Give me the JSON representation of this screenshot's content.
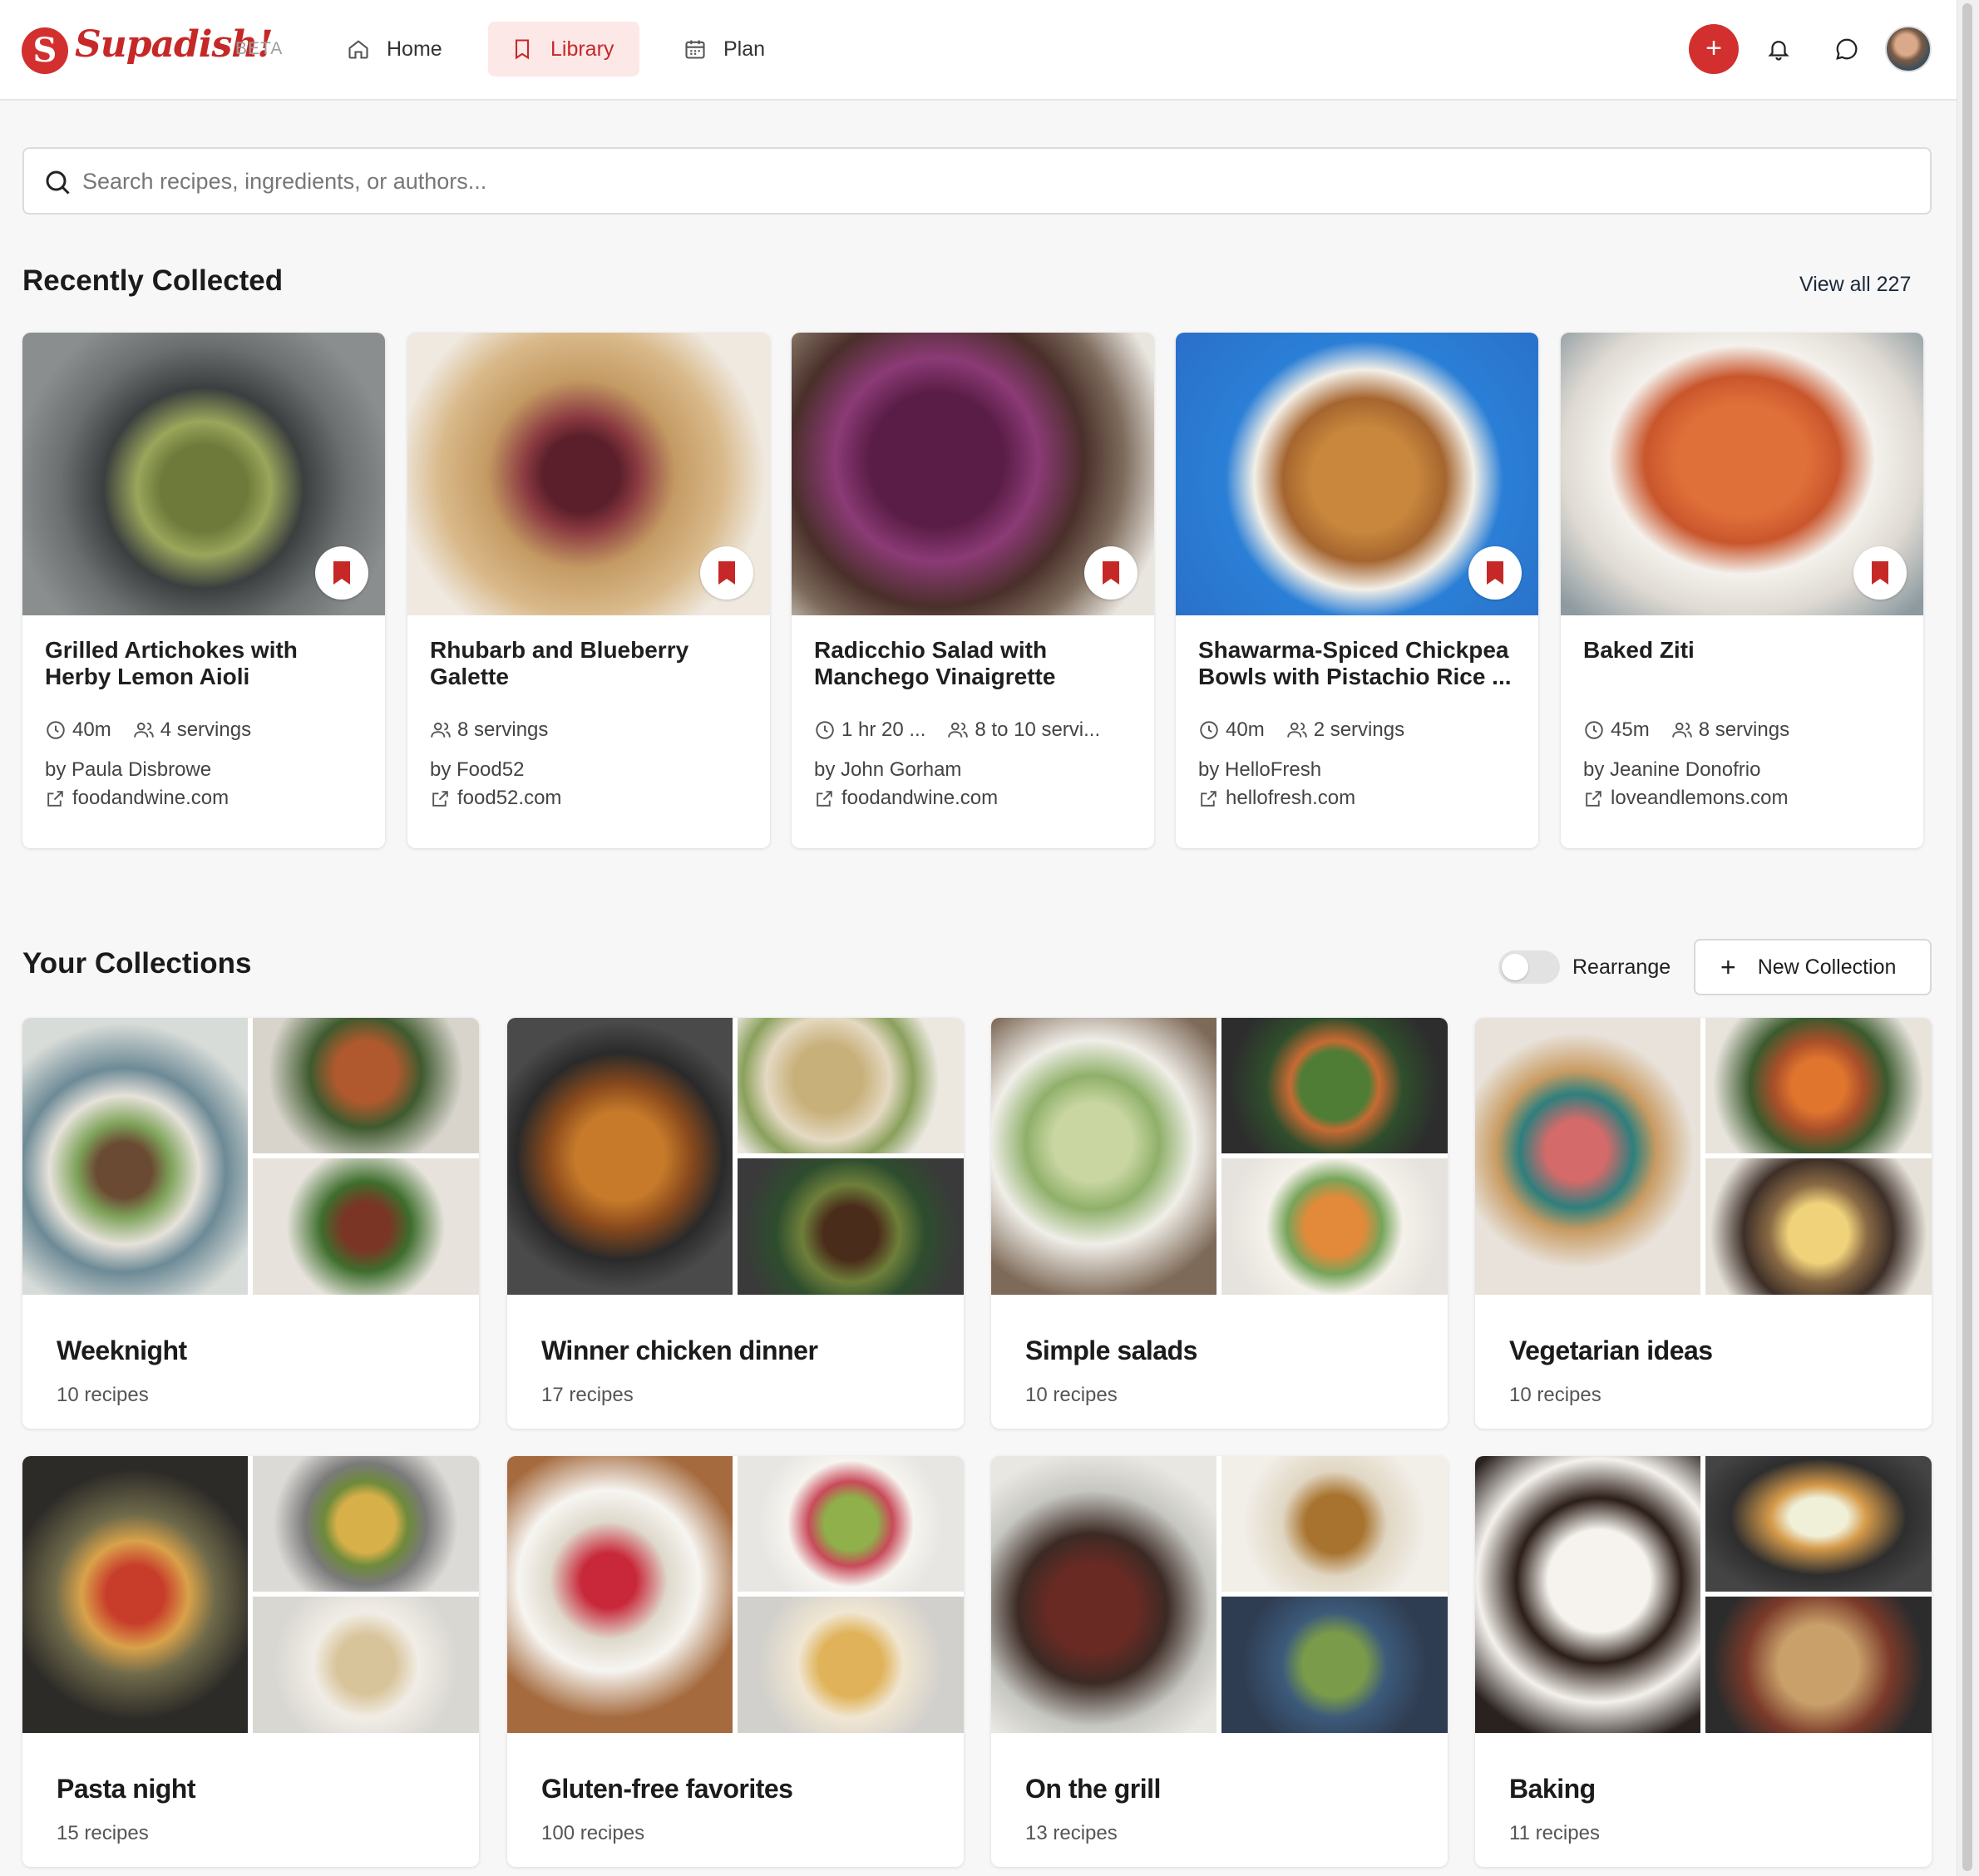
{
  "brand": {
    "logo_letter": "S",
    "name": "Supadish!",
    "badge": "BETA"
  },
  "nav": {
    "home": "Home",
    "library": "Library",
    "plan": "Plan"
  },
  "header_actions": {
    "add": "+"
  },
  "search": {
    "placeholder": "Search recipes, ingredients, or authors..."
  },
  "recently_collected": {
    "title": "Recently Collected",
    "view_all": "View all 227",
    "recipes": [
      {
        "title": "Grilled Artichokes with Herby Lemon Aioli",
        "time": "40m",
        "servings": "4 servings",
        "author": "by Paula Disbrowe",
        "site": "foodandwine.com"
      },
      {
        "title": "Rhubarb and Blueberry Galette",
        "time": "",
        "servings": "8 servings",
        "author": "by Food52",
        "site": "food52.com"
      },
      {
        "title": "Radicchio Salad with Manchego Vinaigrette",
        "time": "1 hr 20 ...",
        "servings": "8 to 10 servi...",
        "author": "by John Gorham",
        "site": "foodandwine.com"
      },
      {
        "title": "Shawarma-Spiced Chickpea Bowls with Pistachio Rice ...",
        "time": "40m",
        "servings": "2 servings",
        "author": "by HelloFresh",
        "site": "hellofresh.com"
      },
      {
        "title": "Baked Ziti",
        "time": "45m",
        "servings": "8 servings",
        "author": "by Jeanine Donofrio",
        "site": "loveandlemons.com"
      }
    ]
  },
  "collections": {
    "title": "Your Collections",
    "rearrange": "Rearrange",
    "rearrange_on": false,
    "new_collection": "New Collection",
    "new_collection_icon": "+",
    "items": [
      {
        "name": "Weeknight",
        "count": "10 recipes"
      },
      {
        "name": "Winner chicken dinner",
        "count": "17 recipes"
      },
      {
        "name": "Simple salads",
        "count": "10 recipes"
      },
      {
        "name": "Vegetarian ideas",
        "count": "10 recipes"
      },
      {
        "name": "Pasta night",
        "count": "15 recipes"
      },
      {
        "name": "Gluten-free favorites",
        "count": "100 recipes"
      },
      {
        "name": "On the grill",
        "count": "13 recipes"
      },
      {
        "name": "Baking",
        "count": "11 recipes"
      }
    ]
  },
  "colors": {
    "accent": "#d32f2f",
    "active_bg": "#fde8e8"
  }
}
